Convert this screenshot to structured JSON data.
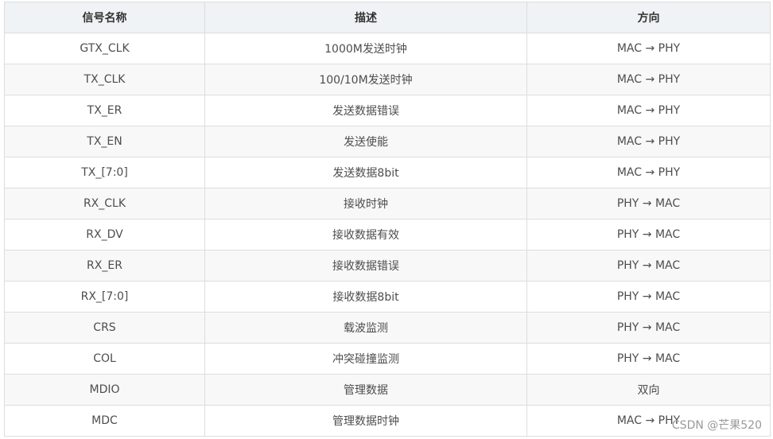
{
  "table": {
    "headers": [
      "信号名称",
      "描述",
      "方向"
    ],
    "rows": [
      [
        "GTX_CLK",
        "1000M发送时钟",
        "MAC → PHY"
      ],
      [
        "TX_CLK",
        "100/10M发送时钟",
        "MAC → PHY"
      ],
      [
        "TX_ER",
        "发送数据错误",
        "MAC → PHY"
      ],
      [
        "TX_EN",
        "发送使能",
        "MAC → PHY"
      ],
      [
        "TX_[7:0]",
        "发送数据8bit",
        "MAC → PHY"
      ],
      [
        "RX_CLK",
        "接收时钟",
        "PHY → MAC"
      ],
      [
        "RX_DV",
        "接收数据有效",
        "PHY → MAC"
      ],
      [
        "RX_ER",
        "接收数据错误",
        "PHY → MAC"
      ],
      [
        "RX_[7:0]",
        "接收数据8bit",
        "PHY → MAC"
      ],
      [
        "CRS",
        "载波监测",
        "PHY → MAC"
      ],
      [
        "COL",
        "冲突碰撞监测",
        "PHY → MAC"
      ],
      [
        "MDIO",
        "管理数据",
        "双向"
      ],
      [
        "MDC",
        "管理数据时钟",
        "MAC → PHY"
      ]
    ]
  },
  "watermark": "CSDN @芒果520"
}
